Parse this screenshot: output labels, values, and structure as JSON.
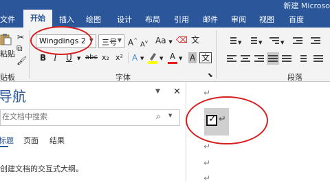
{
  "window": {
    "title_fragment": "新建 Microso"
  },
  "ribbon_tabs": {
    "file_partial": "文件",
    "start": "开始",
    "insert": "插入",
    "draw": "绘图",
    "design": "设计",
    "layout": "布局",
    "references": "引用",
    "mailings": "邮件",
    "review": "审阅",
    "view": "视图",
    "help_partial": "百度"
  },
  "clipboard": {
    "paste_partial": "粘贴",
    "group_label_partial": "贴板"
  },
  "font": {
    "font_name": "Wingdings 2",
    "font_size": "三号",
    "group_label": "字体",
    "grow_label": "A",
    "shrink_label": "A",
    "case_label": "Aa",
    "wen_label": "文",
    "bold_label": "B",
    "italic_label": "I",
    "underline_label": "U",
    "strike_label": "abc",
    "subscript_label": "x₂",
    "superscript_label": "x²",
    "effects_label": "A",
    "font_color_label": "A",
    "char_shade_label": "A"
  },
  "paragraph": {
    "group_label": "段落"
  },
  "nav_pane": {
    "title_partial": "导航",
    "close_icon_text": "✕",
    "search_placeholder": "在文档中搜索",
    "tab_headings_partial": "标题",
    "tab_pages": "页面",
    "tab_results": "结果",
    "hint_text": "创建文档的交互式大纲。"
  },
  "document": {
    "paragraph_mark": "↵",
    "check_glyph": "✓"
  },
  "colors": {
    "ribbon_blue": "#2b579a",
    "annotation_red": "#d81e1e",
    "font_color_red": "#e02020",
    "highlight_yellow": "#ffff00"
  }
}
